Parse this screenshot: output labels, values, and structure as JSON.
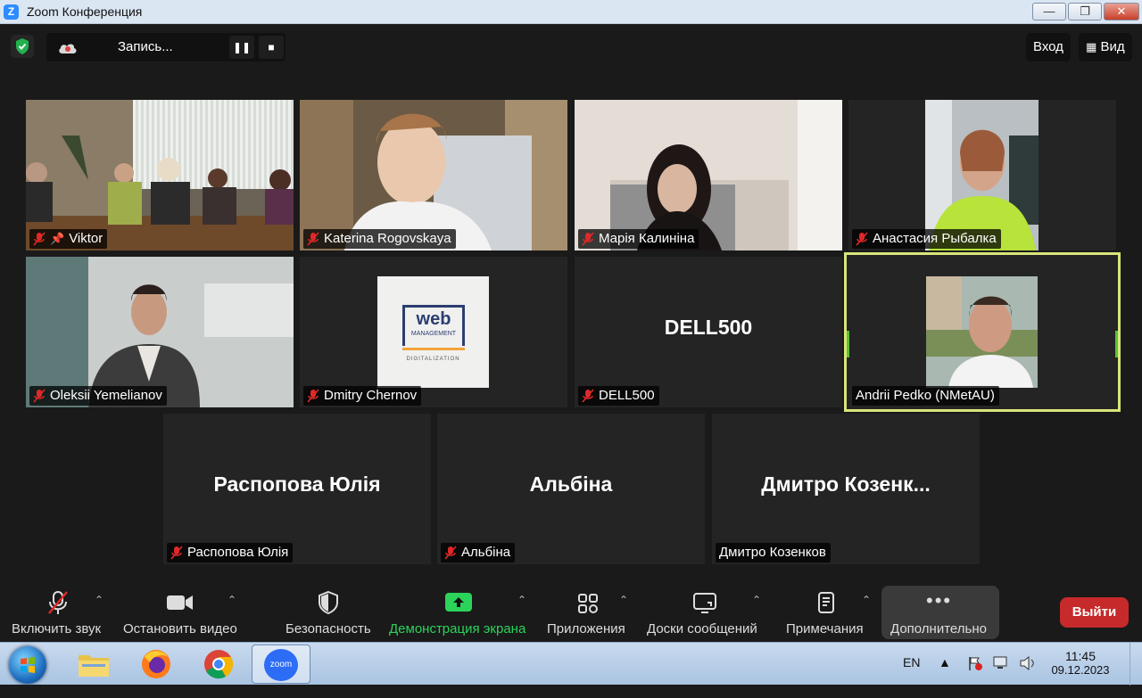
{
  "window": {
    "title": "Zoom Конференция",
    "buttons": [
      "minimize",
      "restore",
      "close"
    ]
  },
  "recording": {
    "label": "Запись...",
    "pause_icon": "pause-icon",
    "stop_icon": "stop-icon"
  },
  "top_right": {
    "enter_label": "Вход",
    "view_label": "Вид"
  },
  "participants": [
    {
      "name": "Viktor",
      "muted": true,
      "pinned": true,
      "video": "photo-group"
    },
    {
      "name": "Katerina Rogovskaya",
      "muted": true,
      "video": "photo-boy"
    },
    {
      "name": "Марія Калиніна",
      "muted": true,
      "video": "photo-girl"
    },
    {
      "name": "Анастасия Рыбалка",
      "muted": true,
      "video": "photo-green"
    },
    {
      "name": "Oleksii Yemelianov",
      "muted": true,
      "video": "photo-man"
    },
    {
      "name": "Dmitry Chernov",
      "muted": true,
      "video": "avatar-web"
    },
    {
      "name": "DELL500",
      "muted": true,
      "display_name": "DELL500"
    },
    {
      "name": "Andrii Pedko (NMetAU)",
      "muted": false,
      "active_speaker": true,
      "video": "photo-portrait"
    },
    {
      "name": "Распопова Юлія",
      "muted": true,
      "display_name": "Распопова Юлія"
    },
    {
      "name": "Альбіна",
      "muted": true,
      "display_name": "Альбіна"
    },
    {
      "name": "Дмитро Козенков",
      "muted": false,
      "display_name": "Дмитро  Козенк..."
    }
  ],
  "web_logo": {
    "main": "web",
    "sub": "MANAGEMENT",
    "tag": "DIGITALIZATION"
  },
  "toolbar": {
    "unmute": "Включить звук",
    "stop_video": "Остановить видео",
    "security": "Безопасность",
    "share": "Демонстрация экрана",
    "apps": "Приложения",
    "whiteboards": "Доски сообщений",
    "notes": "Примечания",
    "more": "Дополнительно",
    "leave": "Выйти",
    "share_color": "#2bd35a",
    "leave_color": "#c72a2a"
  },
  "taskbar": {
    "apps": [
      "windows-explorer",
      "firefox",
      "chrome",
      "zoom"
    ],
    "zoom_label": "zoom",
    "lang": "EN",
    "time": "11:45",
    "date": "09.12.2023"
  }
}
